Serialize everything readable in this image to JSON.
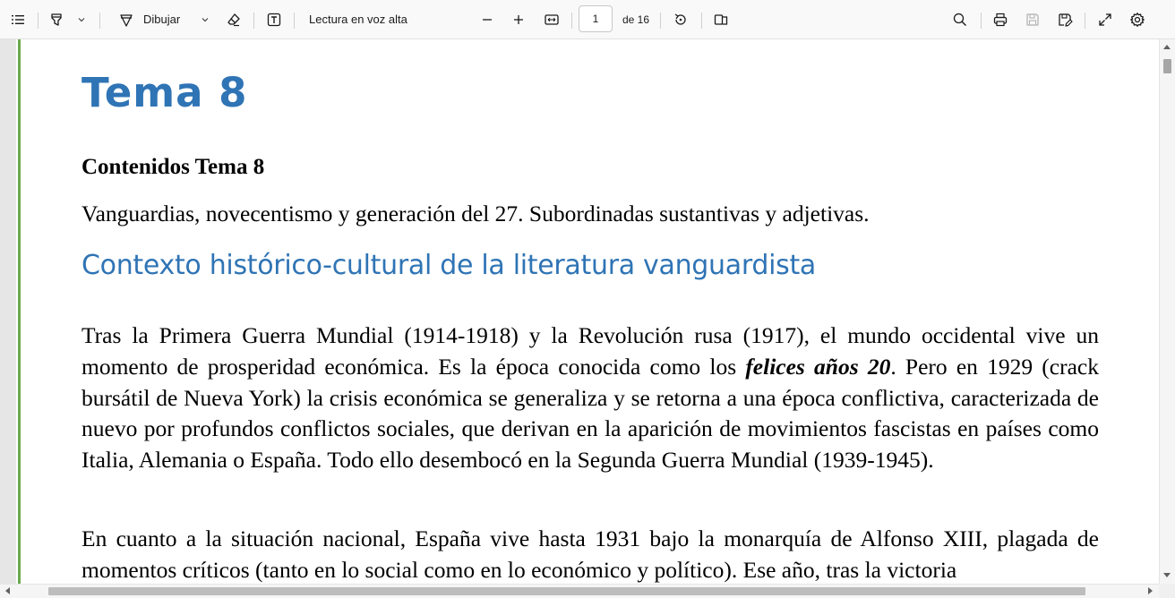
{
  "toolbar": {
    "draw_label": "Dibujar",
    "read_aloud_label": "Lectura en voz alta",
    "page_current": "1",
    "page_total_label": "de 16"
  },
  "document": {
    "title": "Tema 8",
    "contents_heading": "Contenidos Tema 8",
    "contents_text": "Vanguardias, novecentismo y generación del 27. Subordinadas sustantivas y adjetivas.",
    "section_heading": "Contexto histórico-cultural de la literatura vanguardista",
    "para1_part1": "Tras la Primera Guerra Mundial (1914-1918) y la Revolución rusa (1917), el mundo occidental vive un momento de prosperidad económica. Es la época conocida como los ",
    "para1_emphasis": "felices años 20",
    "para1_part2": ". Pero en 1929 (crack bursátil de Nueva York) la crisis económica se generaliza y se retorna a una época conflictiva, caracterizada de nuevo por profundos conflictos sociales, que derivan en la aparición de movimientos fascistas en países como Italia, Alemania o España. Todo ello desembocó en la Segunda Guerra Mundial (1939-1945).",
    "para2": "En cuanto a la situación nacional, España vive hasta 1931 bajo la monarquía de Alfonso XIII, plagada de momentos críticos (tanto en lo social como en lo económico y político). Ese año, tras la victoria"
  },
  "icons": [
    "table-of-contents-icon",
    "highlight-icon",
    "chevron-down-icon",
    "draw-icon",
    "eraser-icon",
    "text-box-icon",
    "zoom-out-icon",
    "zoom-in-icon",
    "fit-width-icon",
    "rotate-icon",
    "page-view-icon",
    "search-icon",
    "print-icon",
    "save-icon",
    "save-as-icon",
    "fullscreen-icon",
    "settings-icon"
  ],
  "colors": {
    "heading_blue": "#2f74b5",
    "margin_bar": "#6aa84f"
  }
}
